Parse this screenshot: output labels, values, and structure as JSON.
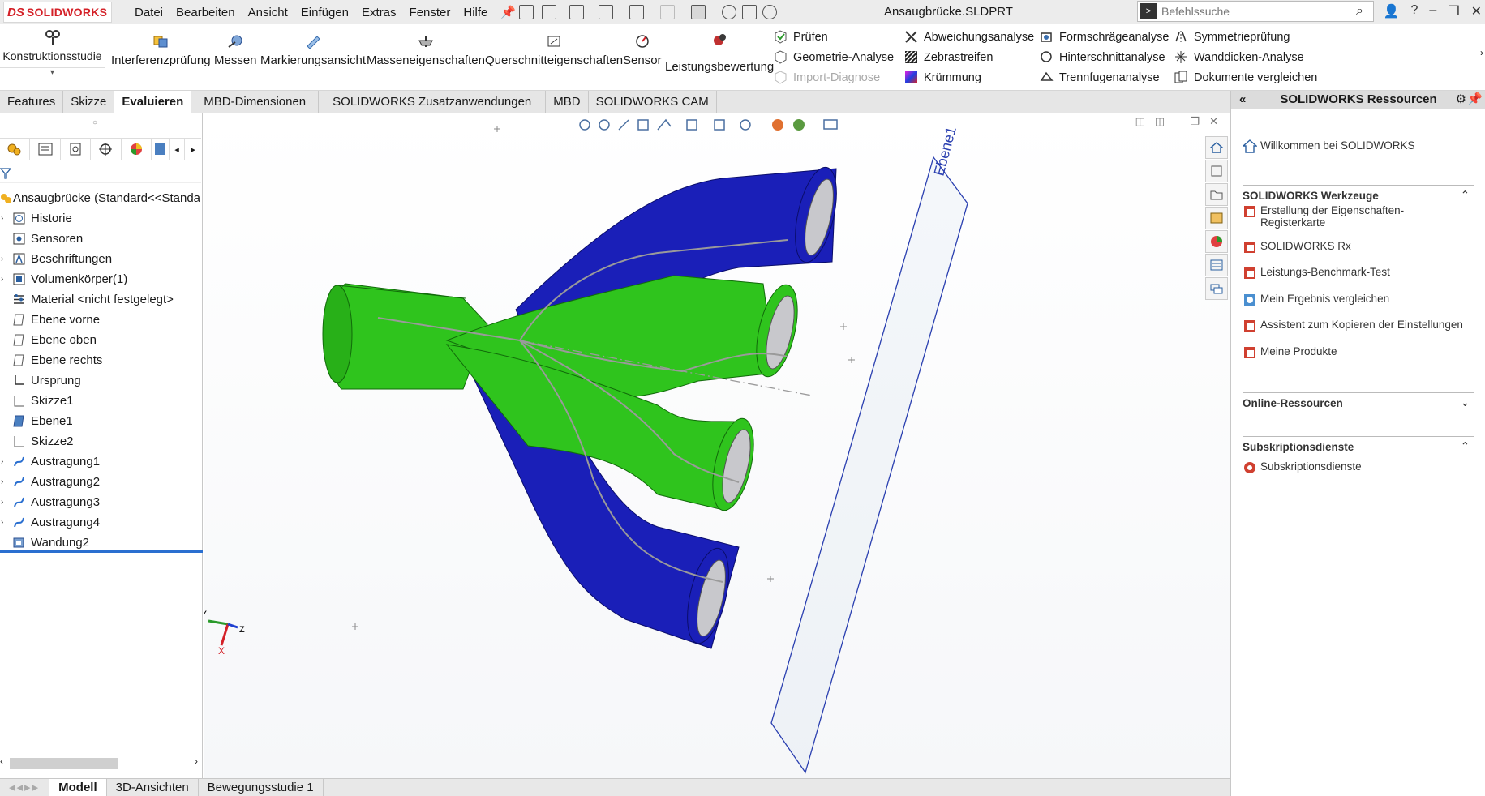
{
  "app": {
    "logo_ds": "DS",
    "logo_name": "SOLIDWORKS",
    "document_title": "Ansaugbrücke.SLDPRT",
    "menu": [
      "Datei",
      "Bearbeiten",
      "Ansicht",
      "Einfügen",
      "Extras",
      "Fenster",
      "Hilfe"
    ],
    "search_placeholder": "Befehlssuche",
    "window_controls": [
      "?",
      "–",
      "❐",
      "✕"
    ]
  },
  "command_manager": {
    "first_tool": "Konstruktionsstudie",
    "big_tools": [
      "Interferenzprüfung",
      "Messen",
      "Markierungsansicht",
      "Masseneigenschaften",
      "Querschnitteigenschaften",
      "Sensor",
      "Leistungsbewertung"
    ],
    "check_tools": [
      "Prüfen",
      "Geometrie-Analyse",
      "Import-Diagnose"
    ],
    "analysis_col1": [
      "Abweichungsanalyse",
      "Zebrastreifen",
      "Krümmung"
    ],
    "analysis_col2": [
      "Formschrägeanalyse",
      "Hinterschnittanalyse",
      "Trennfugenanalyse"
    ],
    "analysis_col3": [
      "Symmetrieprüfung",
      "Wanddicken-Analyse",
      "Dokumente vergleichen"
    ]
  },
  "tabs": [
    "Features",
    "Skizze",
    "Evaluieren",
    "MBD-Dimensionen",
    "SOLIDWORKS Zusatzanwendungen",
    "MBD",
    "SOLIDWORKS CAM"
  ],
  "active_tab": "Evaluieren",
  "feature_tree": {
    "root": "Ansaugbrücke  (Standard<<Standa",
    "items": [
      "Historie",
      "Sensoren",
      "Beschriftungen",
      "Volumenkörper(1)",
      "Material <nicht festgelegt>",
      "Ebene vorne",
      "Ebene oben",
      "Ebene rechts",
      "Ursprung",
      "Skizze1",
      "Ebene1",
      "Skizze2",
      "Austragung1",
      "Austragung2",
      "Austragung3",
      "Austragung4",
      "Wandung2"
    ]
  },
  "bottom_tabs": [
    "Modell",
    "3D-Ansichten",
    "Bewegungsstudie 1"
  ],
  "viewport": {
    "plane_label": "Ebene1",
    "triad": {
      "x": "X",
      "y": "Y",
      "z": "Z"
    },
    "colors": {
      "blue": "#1a1fb8",
      "green": "#2fc41d",
      "opening": "#c8c8cc"
    }
  },
  "resources": {
    "title": "SOLIDWORKS Ressourcen",
    "welcome": "Willkommen bei SOLIDWORKS",
    "section_tools": "SOLIDWORKS Werkzeuge",
    "tools": [
      "Erstellung der Eigenschaften-Registerkarte",
      "SOLIDWORKS Rx",
      "Leistungs-Benchmark-Test",
      "Mein Ergebnis vergleichen",
      "Assistent zum Kopieren der Einstellungen",
      "Meine Produkte"
    ],
    "section_online": "Online-Ressourcen",
    "section_subscr": "Subskriptionsdienste",
    "subscr_item": "Subskriptionsdienste"
  }
}
